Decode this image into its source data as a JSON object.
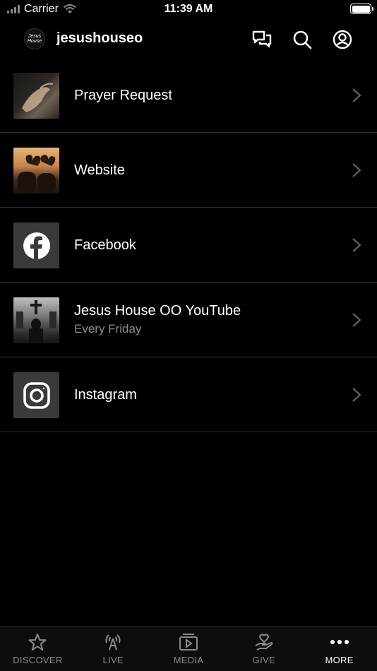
{
  "status_bar": {
    "carrier": "Carrier",
    "time": "11:39 AM"
  },
  "header": {
    "logo_text": "Jesus House",
    "title": "jesushouseo"
  },
  "list": [
    {
      "title": "Prayer Request",
      "subtitle": "",
      "thumb": "praying-hands-photo"
    },
    {
      "title": "Website",
      "subtitle": "",
      "thumb": "heart-hands-sunset-photo"
    },
    {
      "title": "Facebook",
      "subtitle": "",
      "thumb": "facebook-icon"
    },
    {
      "title": "Jesus House OO YouTube",
      "subtitle": "Every Friday",
      "thumb": "church-cross-photo"
    },
    {
      "title": "Instagram",
      "subtitle": "",
      "thumb": "instagram-icon"
    }
  ],
  "tabbar": [
    {
      "label": "DISCOVER",
      "icon": "star-icon",
      "active": false
    },
    {
      "label": "LIVE",
      "icon": "broadcast-icon",
      "active": false
    },
    {
      "label": "MEDIA",
      "icon": "media-player-icon",
      "active": false
    },
    {
      "label": "GIVE",
      "icon": "give-hand-heart-icon",
      "active": false
    },
    {
      "label": "MORE",
      "icon": "more-dots-icon",
      "active": true
    }
  ],
  "colors": {
    "background": "#000000",
    "divider": "#333333",
    "subtitle": "#8e8e8e",
    "tab_inactive": "#8a8a8a",
    "tab_active": "#ffffff"
  }
}
